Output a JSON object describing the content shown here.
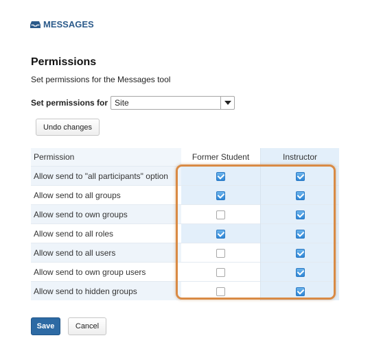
{
  "tool": {
    "title": "MESSAGES",
    "icon": "inbox-icon"
  },
  "page": {
    "heading": "Permissions",
    "instructions": "Set permissions for the Messages tool"
  },
  "set_for": {
    "label": "Set permissions for",
    "selected": "Site"
  },
  "buttons": {
    "undo": "Undo changes",
    "save": "Save",
    "cancel": "Cancel"
  },
  "table": {
    "headers": [
      "Permission",
      "Former Student",
      "Instructor"
    ],
    "rows": [
      {
        "label": "Allow send to \"all participants\" option",
        "former_student": true,
        "instructor": true
      },
      {
        "label": "Allow send to all groups",
        "former_student": true,
        "instructor": true
      },
      {
        "label": "Allow send to own groups",
        "former_student": false,
        "instructor": true
      },
      {
        "label": "Allow send to all roles",
        "former_student": true,
        "instructor": true
      },
      {
        "label": "Allow send to all users",
        "former_student": false,
        "instructor": true
      },
      {
        "label": "Allow send to own group users",
        "former_student": false,
        "instructor": true
      },
      {
        "label": "Allow send to hidden groups",
        "former_student": false,
        "instructor": true
      }
    ]
  },
  "colors": {
    "brand": "#2b5a8a",
    "save_button": "#2d6aa4",
    "highlight": "#d98a44",
    "checked": "#2d86d6"
  }
}
